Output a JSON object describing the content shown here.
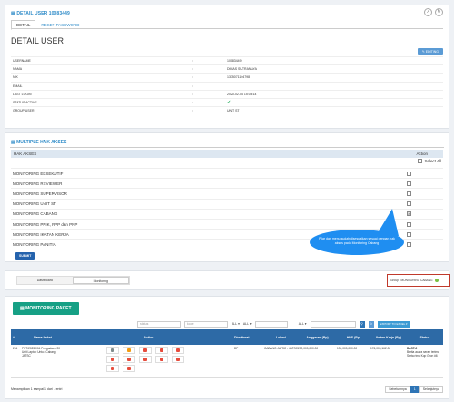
{
  "detail_panel": {
    "title": "DETAIL USER 10083449",
    "tabs": [
      "DETAIL",
      "RESET PASSWORD"
    ],
    "heading": "DETAIL USER",
    "edit_button": "EDITING",
    "rows": [
      {
        "key": "USERNAME",
        "sep": ":",
        "value": "10083449"
      },
      {
        "key": "NAMA",
        "sep": ":",
        "value": "DIMAS SUTRANAYA"
      },
      {
        "key": "NIK",
        "sep": ":",
        "value": "1375071104798"
      },
      {
        "key": "EMAIL",
        "sep": ":",
        "value": ""
      },
      {
        "key": "LAST LOGIN",
        "sep": ":",
        "value": "2020-02-06 15:08:14"
      },
      {
        "key": "STATUS ACTIVE",
        "sep": ":",
        "value": ""
      },
      {
        "key": "GROUP USER",
        "sep": ":",
        "value": "UNIT ST"
      }
    ]
  },
  "access_panel": {
    "title": "MULTIPLE HAK AKSES",
    "header_left": "HAK AKSES",
    "header_right": "Action",
    "select_all": "Select All",
    "items": [
      {
        "label": "MONITORING EKSEKUTIF",
        "checked": false
      },
      {
        "label": "MONITORING REVIEWER",
        "checked": false
      },
      {
        "label": "MONITORING SUPERVISOR",
        "checked": false
      },
      {
        "label": "MONITORING UNIT ST",
        "checked": false
      },
      {
        "label": "MONITORING CABANG",
        "checked": true
      },
      {
        "label": "MONITORING PPIK, PPP dan PNP",
        "checked": false
      },
      {
        "label": "MONITORING IKATAN KERJA",
        "checked": false
      },
      {
        "label": "MONITORING PANITIA",
        "checked": false
      }
    ],
    "submit": "SUBMIT"
  },
  "callout": {
    "text": "Pilar dan menu sudah disesuaikan sesuai dengan hak akses pada Monitoring Cabang"
  },
  "nav": {
    "tabs": [
      "Dashboard",
      "Monitoring"
    ],
    "group": "Group : MONITORING CABANG"
  },
  "monitoring": {
    "button": "MONITORING PAKET",
    "filters": {
      "search1": "status",
      "search2": "kode",
      "sel": "ALL",
      "export": "EXPORT TO EXCEL"
    },
    "headers": [
      "#",
      "Nama Paket",
      "Action",
      "Direktorat",
      "Lokasi",
      "Anggaran (Rp)",
      "HPS (Rp)",
      "Ikatan Kerja (Rp)",
      "Status"
    ],
    "row": {
      "no": "294",
      "nama": "PKT/2023/004 Pengadaan 20 Unit Laptop Untuk Cabang JATSC",
      "direktorat": "DP",
      "lokasi": "CABANG JATSC - JATSC",
      "anggaran": "200,000,000.00",
      "hps": "190,000,000.00",
      "ikatan": "176,000,162.00",
      "status_title": "BAST-2",
      "status_desc": "Berita acara serah terima Serta rima Kop Gron #6"
    },
    "footer": "Menampilkan 1 sampai 1 dari 1 entri",
    "pager": [
      "Sebelumnya",
      "1",
      "Selanjutnya"
    ]
  }
}
